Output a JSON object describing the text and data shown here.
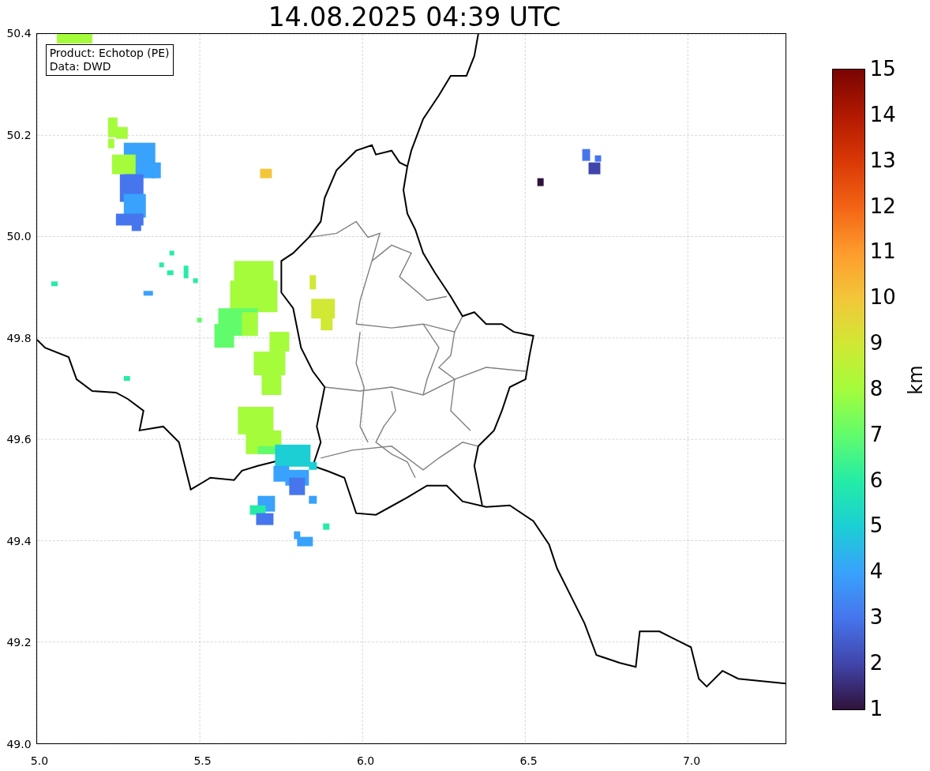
{
  "title": "14.08.2025 04:39 UTC",
  "info_box": [
    "Product: Echotop (PE)",
    "Data: DWD"
  ],
  "y_ticks": [
    "50.4",
    "50.2",
    "50.0",
    "49.8",
    "49.6",
    "49.4",
    "49.2",
    "49.0"
  ],
  "x_ticks": [
    "5.0",
    "5.5",
    "6.0",
    "6.5",
    "7.0"
  ],
  "colorbar": {
    "label": "km",
    "ticks": [
      "15",
      "14",
      "13",
      "12",
      "11",
      "10",
      "9",
      "8",
      "7",
      "6",
      "5",
      "4",
      "3",
      "2",
      "1"
    ]
  }
}
